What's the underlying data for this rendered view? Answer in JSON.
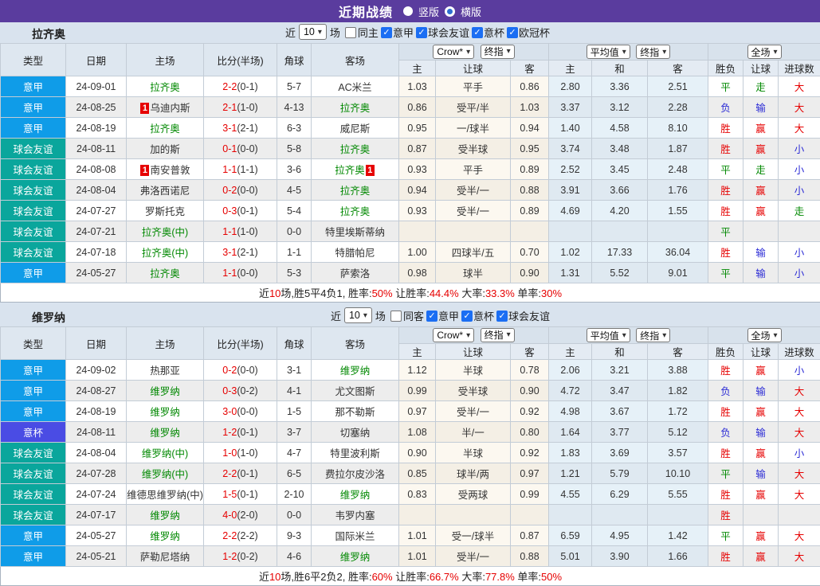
{
  "topbar": {
    "title": "近期战绩",
    "vertical_label": "竖版",
    "horizontal_label": "横版",
    "vertical_selected": true
  },
  "colors": {
    "topbar_bg": "#5a3c9e",
    "serie_a_badge": "#0f9ce8",
    "friendly_badge": "#0aa69c",
    "italy_cup_badge": "#4a4ce4",
    "team_green": "#008800",
    "win_red": "#e60000",
    "lose_blue": "#2b2bd5",
    "checkbox_blue": "#1b6ef3"
  },
  "type_color_map": {
    "意甲": "#0f9ce8",
    "球会友谊": "#0aa69c",
    "意杯": "#4a4ce4"
  },
  "result_class_map": {
    "胜": "r",
    "赢": "r",
    "大": "r",
    "平": "g",
    "走": "g",
    "负": "b",
    "输": "b",
    "小": "b"
  },
  "check_glyph": "✓",
  "arrow_glyph": "▾",
  "sections": [
    {
      "team": "拉齐奥",
      "filter": {
        "near": "近",
        "count": "10",
        "unit": "场",
        "same": {
          "label": "同主",
          "checked": false
        },
        "leagues": [
          {
            "label": "意甲",
            "checked": true
          },
          {
            "label": "球会友谊",
            "checked": true
          },
          {
            "label": "意杯",
            "checked": true
          },
          {
            "label": "欧冠杯",
            "checked": true
          }
        ]
      },
      "selects": {
        "bookmaker": "Crow*",
        "bookmaker_final": "终指",
        "average": "平均值",
        "average_final": "终指",
        "fulltime": "全场"
      },
      "columns": {
        "type": "类型",
        "date": "日期",
        "home": "主场",
        "score": "比分(半场)",
        "corner": "角球",
        "away": "客场",
        "odds_home": "主",
        "odds_line": "让球",
        "odds_away": "客",
        "avg_home": "主",
        "avg_draw": "和",
        "avg_away": "客",
        "result": "胜负",
        "handicap": "让球",
        "goals": "进球数"
      },
      "rows": [
        {
          "type": "意甲",
          "date": "24-09-01",
          "home": {
            "name": "拉齐奥",
            "green": true,
            "card": ""
          },
          "score": "2-2",
          "half": "(0-1)",
          "corner": "5-7",
          "away": {
            "name": "AC米兰",
            "green": false,
            "card": ""
          },
          "crow": [
            "1.03",
            "平手",
            "0.86"
          ],
          "avg": [
            "2.80",
            "3.36",
            "2.51"
          ],
          "outcome": [
            "平",
            "走",
            "大"
          ]
        },
        {
          "type": "意甲",
          "date": "24-08-25",
          "home": {
            "name": "乌迪内斯",
            "green": false,
            "card": "1"
          },
          "score": "2-1",
          "half": "(1-0)",
          "corner": "4-13",
          "away": {
            "name": "拉齐奥",
            "green": true,
            "card": ""
          },
          "crow": [
            "0.86",
            "受平/半",
            "1.03"
          ],
          "avg": [
            "3.37",
            "3.12",
            "2.28"
          ],
          "outcome": [
            "负",
            "输",
            "大"
          ]
        },
        {
          "type": "意甲",
          "date": "24-08-19",
          "home": {
            "name": "拉齐奥",
            "green": true,
            "card": ""
          },
          "score": "3-1",
          "half": "(2-1)",
          "corner": "6-3",
          "away": {
            "name": "威尼斯",
            "green": false,
            "card": ""
          },
          "crow": [
            "0.95",
            "一/球半",
            "0.94"
          ],
          "avg": [
            "1.40",
            "4.58",
            "8.10"
          ],
          "outcome": [
            "胜",
            "赢",
            "大"
          ]
        },
        {
          "type": "球会友谊",
          "date": "24-08-11",
          "home": {
            "name": "加的斯",
            "green": false,
            "card": ""
          },
          "score": "0-1",
          "half": "(0-0)",
          "corner": "5-8",
          "away": {
            "name": "拉齐奥",
            "green": true,
            "card": ""
          },
          "crow": [
            "0.87",
            "受半球",
            "0.95"
          ],
          "avg": [
            "3.74",
            "3.48",
            "1.87"
          ],
          "outcome": [
            "胜",
            "赢",
            "小"
          ]
        },
        {
          "type": "球会友谊",
          "date": "24-08-08",
          "home": {
            "name": "南安普敦",
            "green": false,
            "card": "1"
          },
          "score": "1-1",
          "half": "(1-1)",
          "corner": "3-6",
          "away": {
            "name": "拉齐奥",
            "green": true,
            "card": "1"
          },
          "crow": [
            "0.93",
            "平手",
            "0.89"
          ],
          "avg": [
            "2.52",
            "3.45",
            "2.48"
          ],
          "outcome": [
            "平",
            "走",
            "小"
          ]
        },
        {
          "type": "球会友谊",
          "date": "24-08-04",
          "home": {
            "name": "弗洛西诺尼",
            "green": false,
            "card": ""
          },
          "score": "0-2",
          "half": "(0-0)",
          "corner": "4-5",
          "away": {
            "name": "拉齐奥",
            "green": true,
            "card": ""
          },
          "crow": [
            "0.94",
            "受半/一",
            "0.88"
          ],
          "avg": [
            "3.91",
            "3.66",
            "1.76"
          ],
          "outcome": [
            "胜",
            "赢",
            "小"
          ]
        },
        {
          "type": "球会友谊",
          "date": "24-07-27",
          "home": {
            "name": "罗斯托克",
            "green": false,
            "card": ""
          },
          "score": "0-3",
          "half": "(0-1)",
          "corner": "5-4",
          "away": {
            "name": "拉齐奥",
            "green": true,
            "card": ""
          },
          "crow": [
            "0.93",
            "受半/一",
            "0.89"
          ],
          "avg": [
            "4.69",
            "4.20",
            "1.55"
          ],
          "outcome": [
            "胜",
            "赢",
            "走"
          ]
        },
        {
          "type": "球会友谊",
          "date": "24-07-21",
          "home": {
            "name": "拉齐奥(中)",
            "green": true,
            "card": ""
          },
          "score": "1-1",
          "half": "(1-0)",
          "corner": "0-0",
          "away": {
            "name": "特里埃斯蒂纳",
            "green": false,
            "card": ""
          },
          "crow": [
            "",
            "",
            ""
          ],
          "avg": [
            "",
            "",
            ""
          ],
          "outcome": [
            "平",
            "",
            ""
          ]
        },
        {
          "type": "球会友谊",
          "date": "24-07-18",
          "home": {
            "name": "拉齐奥(中)",
            "green": true,
            "card": ""
          },
          "score": "3-1",
          "half": "(2-1)",
          "corner": "1-1",
          "away": {
            "name": "特腊帕尼",
            "green": false,
            "card": ""
          },
          "crow": [
            "1.00",
            "四球半/五",
            "0.70"
          ],
          "avg": [
            "1.02",
            "17.33",
            "36.04"
          ],
          "outcome": [
            "胜",
            "输",
            "小"
          ]
        },
        {
          "type": "意甲",
          "date": "24-05-27",
          "home": {
            "name": "拉齐奥",
            "green": true,
            "card": ""
          },
          "score": "1-1",
          "half": "(0-0)",
          "corner": "5-3",
          "away": {
            "name": "萨索洛",
            "green": false,
            "card": ""
          },
          "crow": [
            "0.98",
            "球半",
            "0.90"
          ],
          "avg": [
            "1.31",
            "5.52",
            "9.01"
          ],
          "outcome": [
            "平",
            "输",
            "小"
          ]
        }
      ],
      "summary": [
        {
          "text": "近",
          "red": false
        },
        {
          "text": "10",
          "red": true
        },
        {
          "text": "场,胜5平4负1, 胜率:",
          "red": false
        },
        {
          "text": "50%",
          "red": true
        },
        {
          "text": " 让胜率:",
          "red": false
        },
        {
          "text": "44.4%",
          "red": true
        },
        {
          "text": " 大率:",
          "red": false
        },
        {
          "text": "33.3%",
          "red": true
        },
        {
          "text": " 单率:",
          "red": false
        },
        {
          "text": "30%",
          "red": true
        }
      ]
    },
    {
      "team": "维罗纳",
      "filter": {
        "near": "近",
        "count": "10",
        "unit": "场",
        "same": {
          "label": "同客",
          "checked": false
        },
        "leagues": [
          {
            "label": "意甲",
            "checked": true
          },
          {
            "label": "意杯",
            "checked": true
          },
          {
            "label": "球会友谊",
            "checked": true
          }
        ]
      },
      "selects": {
        "bookmaker": "Crow*",
        "bookmaker_final": "终指",
        "average": "平均值",
        "average_final": "终指",
        "fulltime": "全场"
      },
      "columns": {
        "type": "类型",
        "date": "日期",
        "home": "主场",
        "score": "比分(半场)",
        "corner": "角球",
        "away": "客场",
        "odds_home": "主",
        "odds_line": "让球",
        "odds_away": "客",
        "avg_home": "主",
        "avg_draw": "和",
        "avg_away": "客",
        "result": "胜负",
        "handicap": "让球",
        "goals": "进球数"
      },
      "rows": [
        {
          "type": "意甲",
          "date": "24-09-02",
          "home": {
            "name": "热那亚",
            "green": false,
            "card": ""
          },
          "score": "0-2",
          "half": "(0-0)",
          "corner": "3-1",
          "away": {
            "name": "维罗纳",
            "green": true,
            "card": ""
          },
          "crow": [
            "1.12",
            "半球",
            "0.78"
          ],
          "avg": [
            "2.06",
            "3.21",
            "3.88"
          ],
          "outcome": [
            "胜",
            "赢",
            "小"
          ]
        },
        {
          "type": "意甲",
          "date": "24-08-27",
          "home": {
            "name": "维罗纳",
            "green": true,
            "card": ""
          },
          "score": "0-3",
          "half": "(0-2)",
          "corner": "4-1",
          "away": {
            "name": "尤文图斯",
            "green": false,
            "card": ""
          },
          "crow": [
            "0.99",
            "受半球",
            "0.90"
          ],
          "avg": [
            "4.72",
            "3.47",
            "1.82"
          ],
          "outcome": [
            "负",
            "输",
            "大"
          ]
        },
        {
          "type": "意甲",
          "date": "24-08-19",
          "home": {
            "name": "维罗纳",
            "green": true,
            "card": ""
          },
          "score": "3-0",
          "half": "(0-0)",
          "corner": "1-5",
          "away": {
            "name": "那不勒斯",
            "green": false,
            "card": ""
          },
          "crow": [
            "0.97",
            "受半/一",
            "0.92"
          ],
          "avg": [
            "4.98",
            "3.67",
            "1.72"
          ],
          "outcome": [
            "胜",
            "赢",
            "大"
          ]
        },
        {
          "type": "意杯",
          "date": "24-08-11",
          "home": {
            "name": "维罗纳",
            "green": true,
            "card": ""
          },
          "score": "1-2",
          "half": "(0-1)",
          "corner": "3-7",
          "away": {
            "name": "切塞纳",
            "green": false,
            "card": ""
          },
          "crow": [
            "1.08",
            "半/一",
            "0.80"
          ],
          "avg": [
            "1.64",
            "3.77",
            "5.12"
          ],
          "outcome": [
            "负",
            "输",
            "大"
          ]
        },
        {
          "type": "球会友谊",
          "date": "24-08-04",
          "home": {
            "name": "维罗纳(中)",
            "green": true,
            "card": ""
          },
          "score": "1-0",
          "half": "(1-0)",
          "corner": "4-7",
          "away": {
            "name": "特里波利斯",
            "green": false,
            "card": ""
          },
          "crow": [
            "0.90",
            "半球",
            "0.92"
          ],
          "avg": [
            "1.83",
            "3.69",
            "3.57"
          ],
          "outcome": [
            "胜",
            "赢",
            "小"
          ]
        },
        {
          "type": "球会友谊",
          "date": "24-07-28",
          "home": {
            "name": "维罗纳(中)",
            "green": true,
            "card": ""
          },
          "score": "2-2",
          "half": "(0-1)",
          "corner": "6-5",
          "away": {
            "name": "费拉尔皮沙洛",
            "green": false,
            "card": ""
          },
          "crow": [
            "0.85",
            "球半/两",
            "0.97"
          ],
          "avg": [
            "1.21",
            "5.79",
            "10.10"
          ],
          "outcome": [
            "平",
            "输",
            "大"
          ]
        },
        {
          "type": "球会友谊",
          "date": "24-07-24",
          "home": {
            "name": "维德思维罗纳(中)",
            "green": false,
            "card": ""
          },
          "score": "1-5",
          "half": "(0-1)",
          "corner": "2-10",
          "away": {
            "name": "维罗纳",
            "green": true,
            "card": ""
          },
          "crow": [
            "0.83",
            "受两球",
            "0.99"
          ],
          "avg": [
            "4.55",
            "6.29",
            "5.55"
          ],
          "outcome": [
            "胜",
            "赢",
            "大"
          ]
        },
        {
          "type": "球会友谊",
          "date": "24-07-17",
          "home": {
            "name": "维罗纳",
            "green": true,
            "card": ""
          },
          "score": "4-0",
          "half": "(2-0)",
          "corner": "0-0",
          "away": {
            "name": "韦罗内塞",
            "green": false,
            "card": ""
          },
          "crow": [
            "",
            "",
            ""
          ],
          "avg": [
            "",
            "",
            ""
          ],
          "outcome": [
            "胜",
            "",
            ""
          ]
        },
        {
          "type": "意甲",
          "date": "24-05-27",
          "home": {
            "name": "维罗纳",
            "green": true,
            "card": ""
          },
          "score": "2-2",
          "half": "(2-2)",
          "corner": "9-3",
          "away": {
            "name": "国际米兰",
            "green": false,
            "card": ""
          },
          "crow": [
            "1.01",
            "受一/球半",
            "0.87"
          ],
          "avg": [
            "6.59",
            "4.95",
            "1.42"
          ],
          "outcome": [
            "平",
            "赢",
            "大"
          ]
        },
        {
          "type": "意甲",
          "date": "24-05-21",
          "home": {
            "name": "萨勒尼塔纳",
            "green": false,
            "card": ""
          },
          "score": "1-2",
          "half": "(0-2)",
          "corner": "4-6",
          "away": {
            "name": "维罗纳",
            "green": true,
            "card": ""
          },
          "crow": [
            "1.01",
            "受半/一",
            "0.88"
          ],
          "avg": [
            "5.01",
            "3.90",
            "1.66"
          ],
          "outcome": [
            "胜",
            "赢",
            "大"
          ]
        }
      ],
      "summary": [
        {
          "text": "近",
          "red": false
        },
        {
          "text": "10",
          "red": true
        },
        {
          "text": "场,胜6平2负2, 胜率:",
          "red": false
        },
        {
          "text": "60%",
          "red": true
        },
        {
          "text": " 让胜率:",
          "red": false
        },
        {
          "text": "66.7%",
          "red": true
        },
        {
          "text": " 大率:",
          "red": false
        },
        {
          "text": "77.8%",
          "red": true
        },
        {
          "text": " 单率:",
          "red": false
        },
        {
          "text": "50%",
          "red": true
        }
      ]
    }
  ]
}
